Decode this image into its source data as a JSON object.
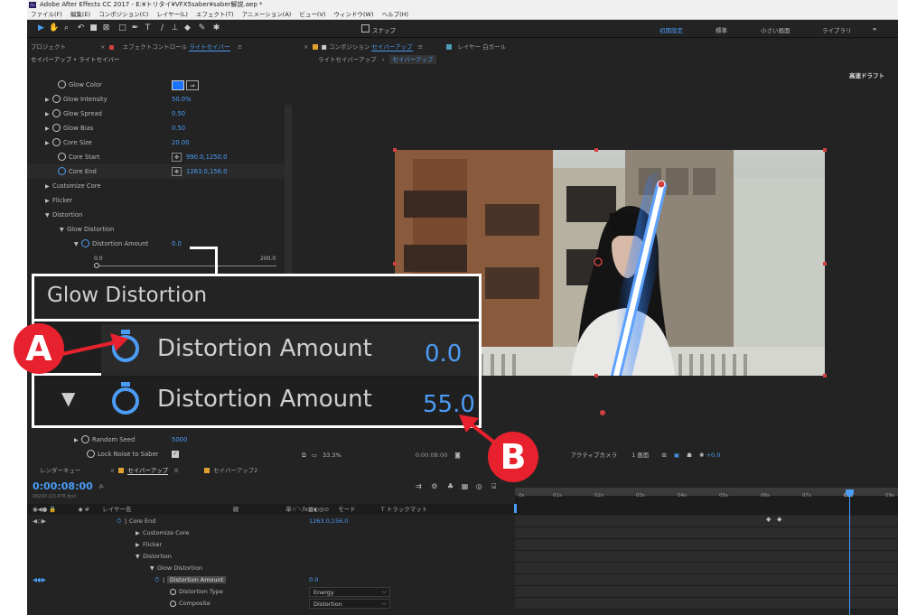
{
  "window": {
    "title": "Adobe After Effects CC 2017 - E:¥トリタイ¥VFX5saber¥saber解説.aep *",
    "app_icon": "Ae"
  },
  "menu": [
    "ファイル(F)",
    "編集(E)",
    "コンポジション(C)",
    "レイヤー(L)",
    "エフェクト(T)",
    "アニメーション(A)",
    "ビュー(V)",
    "ウィンドウ(W)",
    "ヘルプ(H)"
  ],
  "toolbar": {
    "snap_label": "スナップ",
    "workspaces": [
      "初期設定",
      "標準",
      "小さい画面",
      "ライブラリ"
    ],
    "more": "»"
  },
  "left_panel": {
    "tab_project": "プロジェクト",
    "tab_effects_prefix": "エフェクトコントロール",
    "tab_effects_layer": "ライトセイバー",
    "breadcrumb": "セイバーアップ • ライトセイバー",
    "properties": [
      {
        "label": "Glow Color",
        "value": ""
      },
      {
        "label": "Glow Intensity",
        "value": "50.0%"
      },
      {
        "label": "Glow Spread",
        "value": "0.50"
      },
      {
        "label": "Glow Bias",
        "value": "0.50"
      },
      {
        "label": "Core Size",
        "value": "20.00"
      },
      {
        "label": "Core Start",
        "value": "990.0,1250.0"
      },
      {
        "label": "Core End",
        "value": "1263.0,156.0"
      },
      {
        "label": "Customize Core",
        "value": ""
      },
      {
        "label": "Flicker",
        "value": ""
      },
      {
        "label": "Distortion",
        "value": ""
      },
      {
        "label": "Glow Distortion",
        "value": ""
      },
      {
        "label": "Distortion Amount",
        "value": "0.0"
      }
    ],
    "slider_min": "0.0",
    "slider_max": "200.0",
    "random_seed_label": "Random Seed",
    "random_seed_value": "5000",
    "lock_noise_label": "Lock Noise to Saber"
  },
  "comp_panel": {
    "tab_comp_prefix": "コンポジション",
    "tab_comp_name": "セイバーアップ",
    "tab_layer": "レイヤー 白ガール",
    "crumb_parent": "ライトセイバーアップ",
    "crumb_current": "セイバーアップ",
    "draft_label": "高速ドラフト",
    "zoom": "33.3%",
    "timecode": "0:00:08:00",
    "camera": "アクティブカメラ",
    "views": "1 画面",
    "exposure": "+0.0"
  },
  "callout": {
    "group_title": "Glow Distortion",
    "prop_label": "Distortion Amount",
    "value_a": "0.0",
    "value_b": "55.0",
    "badge_a": "A",
    "badge_b": "B"
  },
  "timeline": {
    "tab_render": "レンダーキュー",
    "tab_active": "セイバーアップ",
    "tab_other": "セイバーアップ2",
    "timecode": "0:00:08:00",
    "timecode_sub": "00200 (23.976 fps)",
    "search_placeholder": "ρ.",
    "col_layer_name": "レイヤー名",
    "col_parent": "親",
    "col_mode": "モード",
    "col_trkmat": "T トラックマット",
    "ruler": [
      "0s",
      "01s",
      "02s",
      "03s",
      "04s",
      "05s",
      "06s",
      "07s",
      "08s",
      "09s"
    ],
    "rows": [
      {
        "label": "Core End",
        "value": "1263.0,156.0",
        "indent": 0
      },
      {
        "label": "Customize Core",
        "value": "",
        "indent": 1
      },
      {
        "label": "Flicker",
        "value": "",
        "indent": 1
      },
      {
        "label": "Distortion",
        "value": "",
        "indent": 1
      },
      {
        "label": "Glow Distortion",
        "value": "",
        "indent": 2
      },
      {
        "label": "Distortion Amount",
        "value": "0.0",
        "indent": 3
      },
      {
        "label": "Distortion Type",
        "value": "Energy",
        "indent": 3
      },
      {
        "label": "Composite",
        "value": "Distortion",
        "indent": 3
      }
    ]
  },
  "colors": {
    "accent": "#4b9cf5",
    "badge": "#e8212e",
    "glow": "#1a72ff"
  }
}
